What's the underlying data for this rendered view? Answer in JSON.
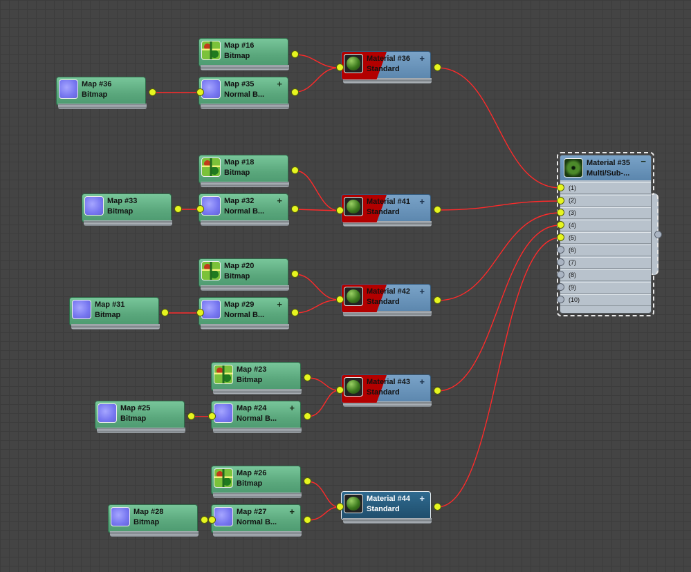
{
  "colors": {
    "background": "#444444",
    "map_node": "#5aa77c",
    "material_node": "#5b86ad",
    "wire": "#ff2a2a",
    "port": "#e6f520"
  },
  "nodes": {
    "map16": {
      "title": "Map #16",
      "sub": "Bitmap",
      "thumb": "map"
    },
    "map35": {
      "title": "Map #35",
      "sub": "Normal B...",
      "thumb": "normal"
    },
    "map36": {
      "title": "Map #36",
      "sub": "Bitmap",
      "thumb": "normal"
    },
    "mat36": {
      "title": "Material #36",
      "sub": "Standard"
    },
    "map18": {
      "title": "Map #18",
      "sub": "Bitmap",
      "thumb": "map"
    },
    "map32": {
      "title": "Map #32",
      "sub": "Normal B...",
      "thumb": "normal"
    },
    "map33": {
      "title": "Map #33",
      "sub": "Bitmap",
      "thumb": "normal"
    },
    "mat41": {
      "title": "Material #41",
      "sub": "Standard"
    },
    "map20": {
      "title": "Map #20",
      "sub": "Bitmap",
      "thumb": "map"
    },
    "map29": {
      "title": "Map #29",
      "sub": "Normal B...",
      "thumb": "normal"
    },
    "map31": {
      "title": "Map #31",
      "sub": "Bitmap",
      "thumb": "normal"
    },
    "mat42": {
      "title": "Material #42",
      "sub": "Standard"
    },
    "map23": {
      "title": "Map #23",
      "sub": "Bitmap",
      "thumb": "map"
    },
    "map24": {
      "title": "Map #24",
      "sub": "Normal B...",
      "thumb": "normal"
    },
    "map25": {
      "title": "Map #25",
      "sub": "Bitmap",
      "thumb": "normal"
    },
    "mat43": {
      "title": "Material #43",
      "sub": "Standard"
    },
    "map26": {
      "title": "Map #26",
      "sub": "Bitmap",
      "thumb": "map"
    },
    "map27": {
      "title": "Map #27",
      "sub": "Normal B...",
      "thumb": "normal"
    },
    "map28": {
      "title": "Map #28",
      "sub": "Bitmap",
      "thumb": "normal"
    },
    "mat44": {
      "title": "Material #44",
      "sub": "Standard"
    },
    "mat35": {
      "title": "Material #35",
      "sub": "Multi/Sub-..."
    }
  },
  "plus_sign": "+",
  "minus_sign": "−",
  "slots": [
    "(1)",
    "(2)",
    "(3)",
    "(4)",
    "(5)",
    "(6)",
    "(7)",
    "(8)",
    "(9)",
    "(10)"
  ]
}
